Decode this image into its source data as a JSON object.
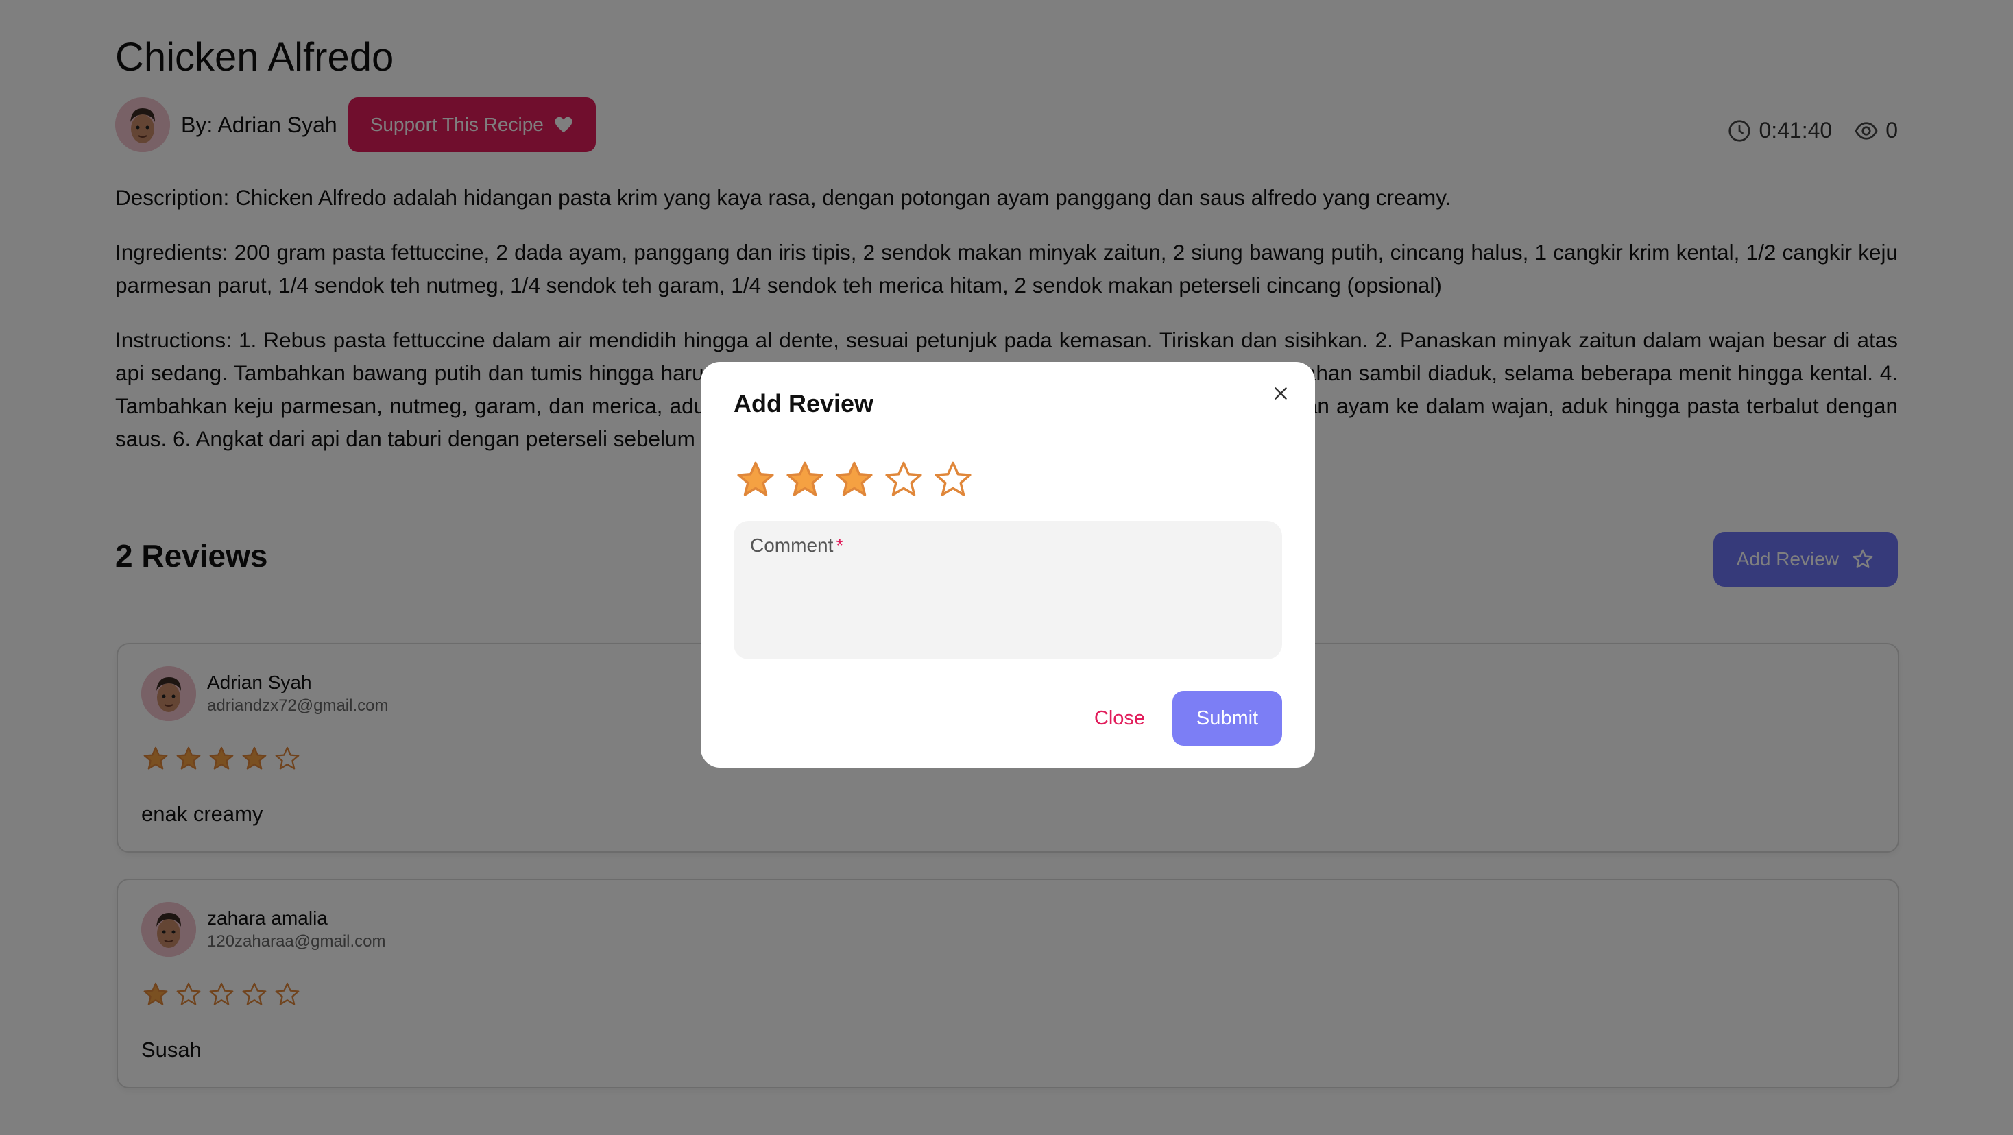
{
  "recipe": {
    "title": "Chicken Alfredo",
    "author": "By: Adrian Syah",
    "support_label": "Support This Recipe",
    "duration": "0:41:40",
    "views": "0",
    "description": "Description: Chicken Alfredo adalah hidangan pasta krim yang kaya rasa, dengan potongan ayam panggang dan saus alfredo yang creamy.",
    "ingredients": "Ingredients: 200 gram pasta fettuccine, 2 dada ayam, panggang dan iris tipis, 2 sendok makan minyak zaitun, 2 siung bawang putih, cincang halus, 1 cangkir krim kental, 1/2 cangkir keju parmesan parut, 1/4 sendok teh nutmeg, 1/4 sendok teh garam, 1/4 sendok teh merica hitam, 2 sendok makan peterseli cincang (opsional)",
    "instructions": "Instructions: 1. Rebus pasta fettuccine dalam air mendidih hingga al dente, sesuai petunjuk pada kemasan. Tiriskan dan sisihkan. 2. Panaskan minyak zaitun dalam wajan besar di atas api sedang. Tambahkan bawang putih dan tumis hingga harum. 3. Tambahkan krim kental dan masak hingga mendidih perlahan sambil diaduk, selama beberapa menit hingga kental. 4. Tambahkan keju parmesan, nutmeg, garam, dan merica, aduk rata hingga saus mengental. 5. Masukkan pasta dan potongan ayam ke dalam wajan, aduk hingga pasta terbalut dengan saus. 6. Angkat dari api dan taburi dengan peterseli sebelum disajikan."
  },
  "reviews": {
    "heading": "2 Reviews",
    "add_label": "Add Review",
    "items": [
      {
        "name": "Adrian Syah",
        "email": "adriandzx72@gmail.com",
        "rating": 4,
        "comment": "enak creamy"
      },
      {
        "name": "zahara amalia",
        "email": "120zaharaa@gmail.com",
        "rating": 1,
        "comment": "Susah"
      }
    ]
  },
  "modal": {
    "title": "Add Review",
    "rating": 3,
    "max_rating": 5,
    "comment_label": "Comment",
    "required_mark": "*",
    "close_label": "Close",
    "submit_label": "Submit"
  },
  "colors": {
    "support": "#e11d5b",
    "add_review": "#6c74f5",
    "submit": "#7c7ef5",
    "star_fill": "#f5a142",
    "star_stroke": "#e0873a"
  }
}
